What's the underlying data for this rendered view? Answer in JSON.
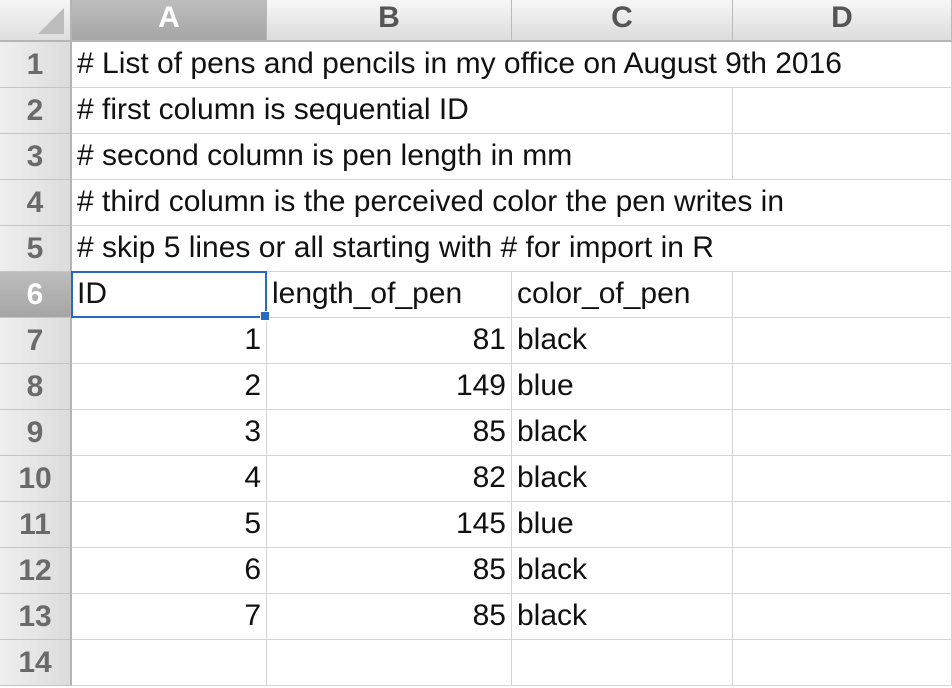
{
  "columns": [
    "A",
    "B",
    "C",
    "D"
  ],
  "rows": [
    {
      "num": "1",
      "a": "# List of pens and pencils in my office on August 9th 2016",
      "b": "",
      "c": "",
      "d": ""
    },
    {
      "num": "2",
      "a": "# first column is sequential ID",
      "b": "",
      "c": "",
      "d": ""
    },
    {
      "num": "3",
      "a": "# second column is pen length in mm",
      "b": "",
      "c": "",
      "d": ""
    },
    {
      "num": "4",
      "a": "# third column is the perceived color the pen writes in",
      "b": "",
      "c": "",
      "d": ""
    },
    {
      "num": "5",
      "a": "# skip 5 lines or all starting with # for import in R",
      "b": "",
      "c": "",
      "d": ""
    },
    {
      "num": "6",
      "a": "ID",
      "b": "length_of_pen",
      "c": "color_of_pen",
      "d": ""
    },
    {
      "num": "7",
      "a": "1",
      "b": "81",
      "c": "black",
      "d": ""
    },
    {
      "num": "8",
      "a": "2",
      "b": "149",
      "c": "blue",
      "d": ""
    },
    {
      "num": "9",
      "a": "3",
      "b": "85",
      "c": "black",
      "d": ""
    },
    {
      "num": "10",
      "a": "4",
      "b": "82",
      "c": "black",
      "d": ""
    },
    {
      "num": "11",
      "a": "5",
      "b": "145",
      "c": "blue",
      "d": ""
    },
    {
      "num": "12",
      "a": "6",
      "b": "85",
      "c": "black",
      "d": ""
    },
    {
      "num": "13",
      "a": "7",
      "b": "85",
      "c": "black",
      "d": ""
    },
    {
      "num": "14",
      "a": "",
      "b": "",
      "c": "",
      "d": ""
    }
  ],
  "selection": {
    "cell": "A6",
    "color": "#2869c6"
  }
}
